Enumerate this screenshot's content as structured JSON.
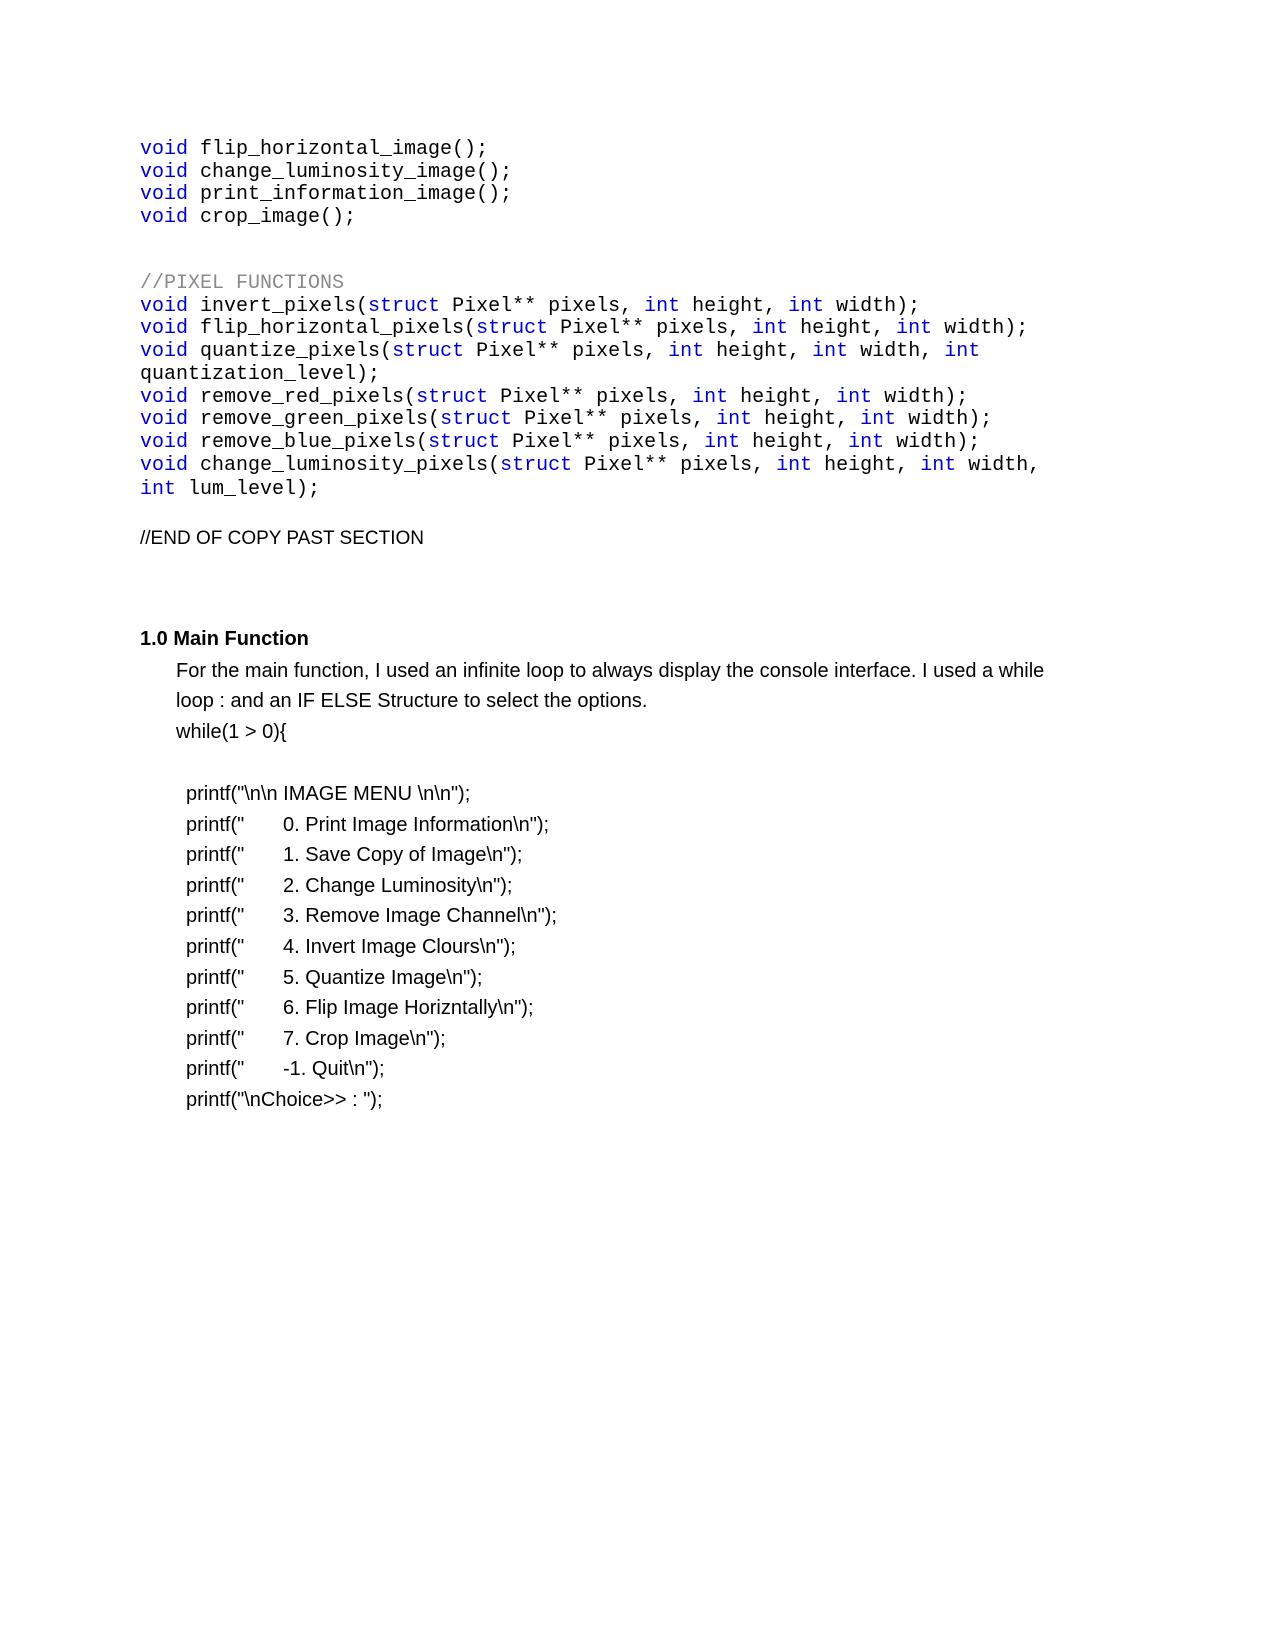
{
  "code_block_1": [
    [
      [
        "void",
        "kw"
      ],
      [
        " flip_horizontal_image();",
        "tx"
      ]
    ],
    [
      [
        "void",
        "kw"
      ],
      [
        " change_luminosity_image();",
        "tx"
      ]
    ],
    [
      [
        "void",
        "kw"
      ],
      [
        " print_information_image();",
        "tx"
      ]
    ],
    [
      [
        "void",
        "kw"
      ],
      [
        " crop_image();",
        "tx"
      ]
    ]
  ],
  "code_block_2": [
    [
      [
        "//PIXEL FUNCTIONS",
        "cm"
      ]
    ],
    [
      [
        "void",
        "kw"
      ],
      [
        " invert_pixels(",
        "tx"
      ],
      [
        "struct",
        "kw"
      ],
      [
        " Pixel** pixels, ",
        "tx"
      ],
      [
        "int",
        "kw"
      ],
      [
        " height, ",
        "tx"
      ],
      [
        "int",
        "kw"
      ],
      [
        " width);",
        "tx"
      ]
    ],
    [
      [
        "void",
        "kw"
      ],
      [
        " flip_horizontal_pixels(",
        "tx"
      ],
      [
        "struct",
        "kw"
      ],
      [
        " Pixel** pixels, ",
        "tx"
      ],
      [
        "int",
        "kw"
      ],
      [
        " height, ",
        "tx"
      ],
      [
        "int",
        "kw"
      ],
      [
        " width);",
        "tx"
      ]
    ],
    [
      [
        "void",
        "kw"
      ],
      [
        " quantize_pixels(",
        "tx"
      ],
      [
        "struct",
        "kw"
      ],
      [
        " Pixel** pixels, ",
        "tx"
      ],
      [
        "int",
        "kw"
      ],
      [
        " height, ",
        "tx"
      ],
      [
        "int",
        "kw"
      ],
      [
        " width, ",
        "tx"
      ],
      [
        "int",
        "kw"
      ]
    ],
    [
      [
        "quantization_level);",
        "tx"
      ]
    ],
    [
      [
        "void",
        "kw"
      ],
      [
        " remove_red_pixels(",
        "tx"
      ],
      [
        "struct",
        "kw"
      ],
      [
        " Pixel** pixels, ",
        "tx"
      ],
      [
        "int",
        "kw"
      ],
      [
        " height, ",
        "tx"
      ],
      [
        "int",
        "kw"
      ],
      [
        " width);",
        "tx"
      ]
    ],
    [
      [
        "void",
        "kw"
      ],
      [
        " remove_green_pixels(",
        "tx"
      ],
      [
        "struct",
        "kw"
      ],
      [
        " Pixel** pixels, ",
        "tx"
      ],
      [
        "int",
        "kw"
      ],
      [
        " height, ",
        "tx"
      ],
      [
        "int",
        "kw"
      ],
      [
        " width);",
        "tx"
      ]
    ],
    [
      [
        "void",
        "kw"
      ],
      [
        " remove_blue_pixels(",
        "tx"
      ],
      [
        "struct",
        "kw"
      ],
      [
        " Pixel** pixels, ",
        "tx"
      ],
      [
        "int",
        "kw"
      ],
      [
        " height, ",
        "tx"
      ],
      [
        "int",
        "kw"
      ],
      [
        " width);",
        "tx"
      ]
    ],
    [
      [
        "void",
        "kw"
      ],
      [
        " change_luminosity_pixels(",
        "tx"
      ],
      [
        "struct",
        "kw"
      ],
      [
        " Pixel** pixels, ",
        "tx"
      ],
      [
        "int",
        "kw"
      ],
      [
        " height, ",
        "tx"
      ],
      [
        "int",
        "kw"
      ],
      [
        " width,",
        "tx"
      ]
    ],
    [
      [
        "int",
        "kw"
      ],
      [
        " lum_level);",
        "tx"
      ]
    ]
  ],
  "colors": {
    "keyword": "#0000cc",
    "comment": "#8a8a8a",
    "text": "#000000"
  },
  "end_note": "//END OF COPY PAST SECTION",
  "heading": "1.0  Main Function",
  "paragraph": [
    "For the main function, I used an infinite loop to always display the console interface. I used a while",
    "loop  :   and an IF ELSE Structure to select the options.",
    "while(1 > 0){"
  ],
  "menu_first": "printf(\"\\n\\n IMAGE MENU \\n\\n\");",
  "menu_rows": [
    [
      "printf(\"",
      "0. Print Image Information\\n\");"
    ],
    [
      "printf(\"",
      "1. Save Copy of Image\\n\");"
    ],
    [
      "printf(\"",
      "2. Change Luminosity\\n\");"
    ],
    [
      "printf(\"",
      "3. Remove Image Channel\\n\");"
    ],
    [
      "printf(\"",
      "4. Invert Image Clours\\n\");"
    ],
    [
      "printf(\"",
      "5. Quantize Image\\n\");"
    ],
    [
      "printf(\"",
      "6. Flip Image Horizntally\\n\");"
    ],
    [
      "printf(\"",
      "7. Crop Image\\n\");"
    ],
    [
      "printf(\"",
      "-1. Quit\\n\");"
    ]
  ],
  "menu_last": "printf(\"\\nChoice>> : \");"
}
